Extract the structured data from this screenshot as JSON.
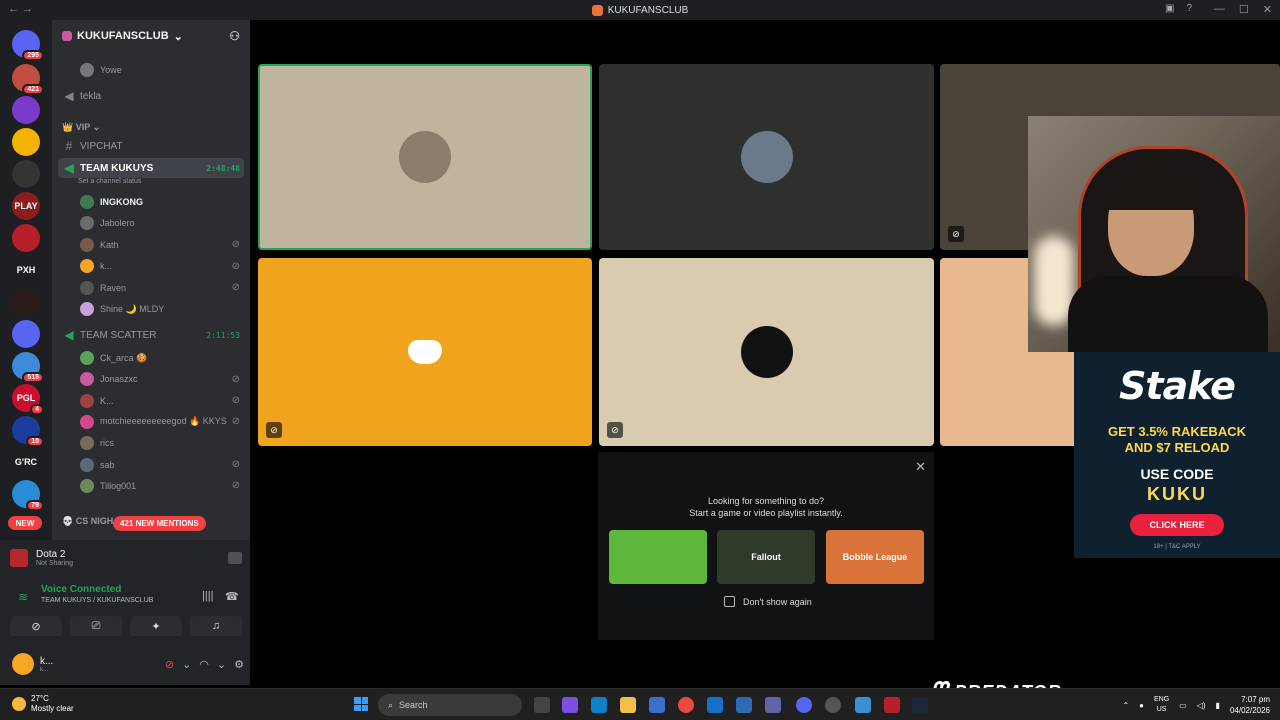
{
  "window": {
    "title": "KUKUFANSCLUB"
  },
  "server_rail": [
    {
      "label": "",
      "badge": "295",
      "color": "#5865f2"
    },
    {
      "label": "",
      "badge": "421",
      "color": "#c24e3f"
    },
    {
      "label": "",
      "badge": "",
      "color": "#7a3cc8"
    },
    {
      "label": "",
      "badge": "",
      "color": "#f5b301"
    },
    {
      "label": "",
      "badge": "",
      "color": "#333333"
    },
    {
      "label": "PLAY",
      "badge": "",
      "color": "#8a1d1d"
    },
    {
      "label": "",
      "badge": "",
      "color": "#b5202a"
    },
    {
      "label": "PXH",
      "badge": "",
      "color": "#1e1f22"
    },
    {
      "label": "",
      "badge": "",
      "color": "#2b1b1b"
    },
    {
      "label": "",
      "badge": "",
      "color": "#5865f2"
    },
    {
      "label": "",
      "badge": "515",
      "color": "#3d8bd9"
    },
    {
      "label": "PGL",
      "badge": "4",
      "color": "#c8102e"
    },
    {
      "label": "",
      "badge": "10",
      "color": "#1a3d9e"
    },
    {
      "label": "G'RC",
      "badge": "",
      "color": "#1e1f22"
    },
    {
      "label": "",
      "badge": "79",
      "color": "#2b8cd6"
    }
  ],
  "sidebar": {
    "server_name": "KUKUFANSCLUB",
    "new_badge": "NEW",
    "mentions_badge": "421 NEW MENTIONS",
    "top_user": "Yowe",
    "channel_tekla": "tekla",
    "category_vip": "VIP",
    "channel_vipchat": "VIPCHAT",
    "team_kukuys": {
      "name": "TEAM KUKUYS",
      "timer": "2:48:48",
      "status": "Set a channel status",
      "members": [
        {
          "name": "INGKONG",
          "muted": "",
          "color": "#3f7a4f"
        },
        {
          "name": "Jabolero",
          "muted": "",
          "color": "#6b6b6b"
        },
        {
          "name": "Kath",
          "muted": "⊘",
          "color": "#7a5a4a"
        },
        {
          "name": "k...",
          "muted": "⊘",
          "color": "#f5a623"
        },
        {
          "name": "Raven",
          "muted": "⊘",
          "color": "#555555"
        },
        {
          "name": "Shine 🌙 MLDY",
          "muted": "",
          "color": "#c9a0dc"
        }
      ]
    },
    "team_scatter": {
      "name": "TEAM SCATTER",
      "timer": "2:11:53",
      "members": [
        {
          "name": "Ck_arca 🍪",
          "muted": "",
          "color": "#5ba35b"
        },
        {
          "name": "Jonaszxc",
          "muted": "⊘",
          "color": "#c85a9e"
        },
        {
          "name": "K...",
          "muted": "⊘",
          "color": "#a04040"
        },
        {
          "name": "motchieeeeeeeeegod 🔥 KKYS",
          "muted": "⊘",
          "color": "#d04a8a"
        },
        {
          "name": "rics",
          "muted": "",
          "color": "#7a6a5a"
        },
        {
          "name": "sab",
          "muted": "⊘",
          "color": "#5a6a7a"
        },
        {
          "name": "Tillog001",
          "muted": "⊘",
          "color": "#6a8a5a"
        }
      ]
    },
    "category_cs": "CS NIGH"
  },
  "panel": {
    "game": "Dota 2",
    "game_status": "Not Sharing",
    "voice_status": "Voice Connected",
    "voice_channel": "TEAM KUKUYS / KUKUFANSCLUB",
    "username": "k...",
    "username_sub": "k..."
  },
  "tiles": [
    {
      "bg": "#beb59c",
      "avatar": "#8a7d6a",
      "muted": false,
      "speaking": true,
      "kind": "photo"
    },
    {
      "bg": "#2e302d",
      "avatar": "#6b7a8a",
      "muted": false,
      "speaking": false,
      "kind": "photo"
    },
    {
      "bg": "#4b423a",
      "avatar": "",
      "muted": true,
      "speaking": false,
      "kind": "empty"
    },
    {
      "bg": "#f0a41e",
      "avatar": "",
      "muted": true,
      "speaking": false,
      "kind": "discord"
    },
    {
      "bg": "#d8cbb0",
      "avatar": "#111111",
      "muted": true,
      "speaking": false,
      "kind": "photo"
    },
    {
      "bg": "#e8b98e",
      "avatar": "",
      "muted": false,
      "speaking": false,
      "kind": "empty"
    }
  ],
  "activity_popup": {
    "line1": "Looking for something to do?",
    "line2": "Start a game or video playlist instantly.",
    "games": [
      {
        "label": "",
        "bg": "#5fb83c"
      },
      {
        "label": "Fallout",
        "bg": "#2f3a2a"
      },
      {
        "label": "Bobble League",
        "bg": "#d9733a"
      }
    ],
    "checkbox_label": "Don't show again"
  },
  "ad": {
    "brand": "Stake",
    "line1": "GET 3.5% RAKEBACK",
    "line2": "AND $7 RELOAD",
    "line3": "USE CODE",
    "code": "KUKU",
    "button": "CLICK HERE",
    "terms": "18+ | T&C APPLY"
  },
  "watermark": "PREDATOR",
  "taskbar": {
    "temp": "27°C",
    "weather": "Mostly clear",
    "search_placeholder": "Search",
    "lang1": "ENG",
    "lang2": "US",
    "time": "7:07 pm",
    "date": "04/02/2026"
  }
}
